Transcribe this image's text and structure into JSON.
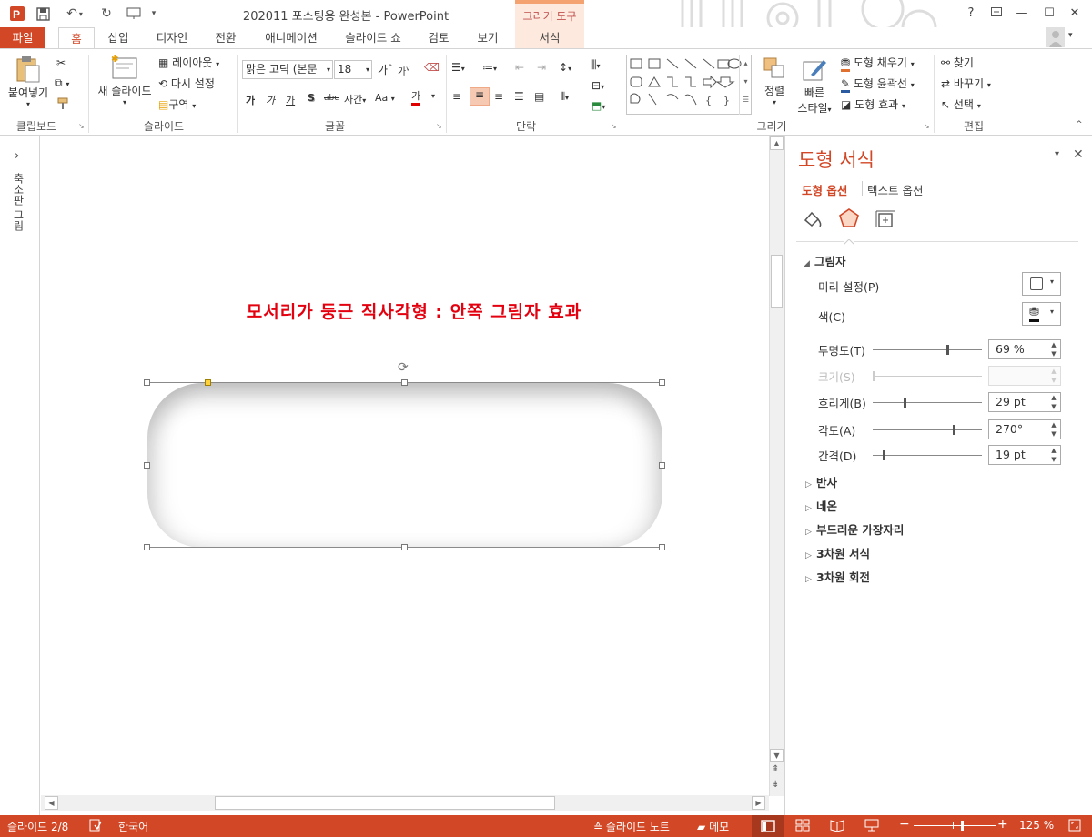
{
  "window": {
    "title": "202011 포스팅용 완성본 - PowerPoint",
    "context_tab_group": "그리기 도구",
    "help": "?",
    "controls": [
      "restore-icon",
      "minimize-icon",
      "maximize-icon",
      "close-icon"
    ]
  },
  "tabs": [
    "파일",
    "홈",
    "삽입",
    "디자인",
    "전환",
    "애니메이션",
    "슬라이드 쇼",
    "검토",
    "보기",
    "서식"
  ],
  "active_tab": "홈",
  "ribbon": {
    "clipboard": {
      "label": "클립보드",
      "paste": "붙여넣기"
    },
    "slides": {
      "label": "슬라이드",
      "new_slide": "새 슬라이드",
      "layout": "레이아웃",
      "reset": "다시 설정",
      "section": "구역"
    },
    "font": {
      "label": "글꼴",
      "font_name": "맑은 고딕 (본문",
      "font_size": "18",
      "bold": "가",
      "italic": "가",
      "underline": "가",
      "shadow": "S",
      "strike": "abc",
      "spacing": "자간",
      "case": "Aa",
      "color": "가"
    },
    "paragraph": {
      "label": "단락"
    },
    "drawing": {
      "label": "그리기",
      "arrange": "정렬",
      "quick_styles_line1": "빠른",
      "quick_styles_line2": "스타일",
      "fill": "도형 채우기",
      "outline": "도형 윤곽선",
      "effects": "도형 효과"
    },
    "editing": {
      "label": "편집",
      "find": "찾기",
      "replace": "바꾸기",
      "select": "선택"
    }
  },
  "left_pane": {
    "label": "축소판 그림",
    "expand": "›"
  },
  "slide": {
    "title": "모서리가 둥근 직사각형 : 안쪽 그림자 효과"
  },
  "format_pane": {
    "title": "도형 서식",
    "tabs": [
      "도형 옵션",
      "텍스트 옵션"
    ],
    "active_tab": "도형 옵션",
    "section": "그림자",
    "preset_label": "미리 설정(P)",
    "color_label": "색(C)",
    "properties": [
      {
        "label": "투명도(T)",
        "value": "69 %",
        "level": 0.69,
        "enabled": true
      },
      {
        "label": "크기(S)",
        "value": "",
        "level": 0.0,
        "enabled": false
      },
      {
        "label": "흐리게(B)",
        "value": "29 pt",
        "level": 0.29,
        "enabled": true
      },
      {
        "label": "각도(A)",
        "value": "270°",
        "level": 0.75,
        "enabled": true
      },
      {
        "label": "간격(D)",
        "value": "19 pt",
        "level": 0.09,
        "enabled": true
      }
    ],
    "collapsed_sections": [
      "반사",
      "네온",
      "부드러운 가장자리",
      "3차원 서식",
      "3차원 회전"
    ]
  },
  "status_bar": {
    "slide_info": "슬라이드 2/8",
    "language": "한국어",
    "notes": "슬라이드 노트",
    "comments": "메모",
    "zoom": "125 %",
    "zoom_level": 0.6,
    "minus": "−",
    "plus": "+"
  },
  "colors": {
    "accent": "#d24726",
    "title_red": "#e3000f",
    "ctx_tab": "#fde9dd"
  }
}
